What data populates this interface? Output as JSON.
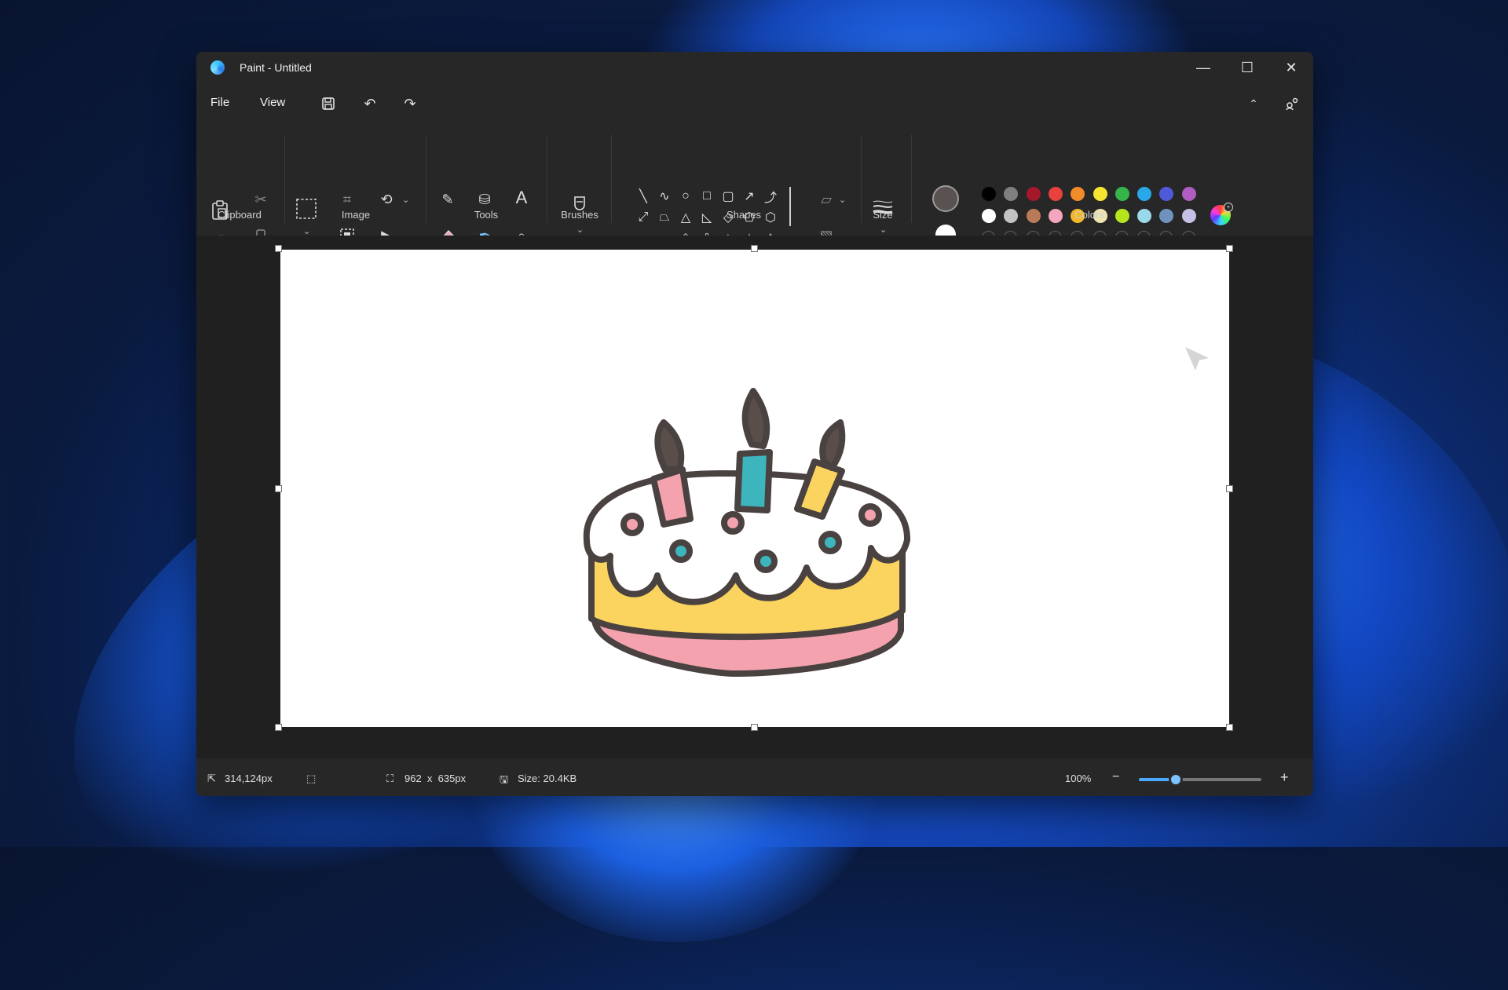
{
  "window": {
    "title": "Paint - Untitled"
  },
  "menu": {
    "file": "File",
    "view": "View"
  },
  "ribbon": {
    "groups": {
      "clipboard": "Clipboard",
      "image": "Image",
      "tools": "Tools",
      "brushes": "Brushes",
      "shapes": "Shapes",
      "size": "Size",
      "colors": "Colors"
    }
  },
  "colors": {
    "primary": "#5a5250",
    "secondary": "#ffffff",
    "palette_row1": [
      "#000000",
      "#7f7f7f",
      "#a3182a",
      "#e8413e",
      "#f08c2a",
      "#f5e532",
      "#36b54a",
      "#2aa7e8",
      "#4f5ad8",
      "#b05cc0"
    ],
    "palette_row2": [
      "#ffffff",
      "#c3c3c3",
      "#b97a57",
      "#f3a6bd",
      "#f2b82a",
      "#efe4b0",
      "#b5e61d",
      "#99d9ea",
      "#7092be",
      "#c8bfe7"
    ],
    "custom_slots": 10
  },
  "status": {
    "cursor_pos": "314,124px",
    "canvas_size": "962  x  635px",
    "file_size": "Size: 20.4KB",
    "zoom": "100%",
    "zoom_fraction": 0.3
  },
  "icons": [
    "paste-icon",
    "cut-icon",
    "copy-icon",
    "select-icon",
    "crop-icon",
    "resize-icon",
    "rotate-icon",
    "pencil-icon",
    "fill-icon",
    "text-icon",
    "eraser-icon",
    "color-picker-icon",
    "magnifier-icon",
    "brush-icon",
    "outline-icon",
    "fill-style-icon",
    "size-icon",
    "edit-colors-icon",
    "save-icon",
    "undo-icon",
    "redo-icon",
    "collapse-ribbon-icon",
    "share-icon",
    "pointer-icon",
    "selection-icon",
    "canvas-size-icon",
    "file-size-icon",
    "zoom-out-icon",
    "zoom-in-icon"
  ]
}
